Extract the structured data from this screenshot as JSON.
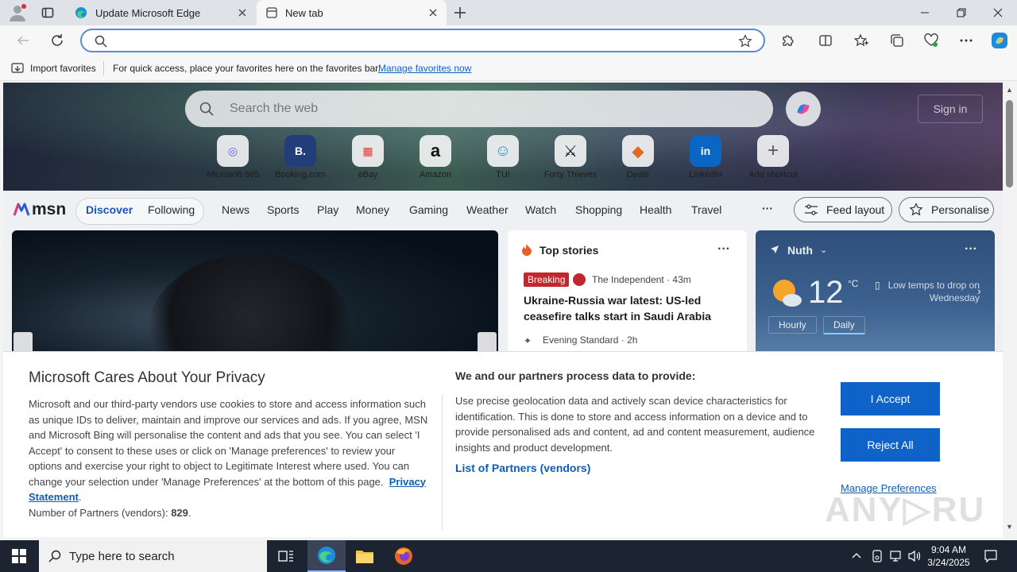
{
  "tabs": [
    {
      "title": "Update Microsoft Edge",
      "active": false
    },
    {
      "title": "New tab",
      "active": true
    }
  ],
  "address_bar": {
    "value": ""
  },
  "favorites_bar": {
    "import_label": "Import favorites",
    "hint": "For quick access, place your favorites here on the favorites bar.",
    "manage_link": "Manage favorites now"
  },
  "newtab": {
    "search_placeholder": "Search the web",
    "sign_in": "Sign in",
    "shortcuts": [
      {
        "label": "Microsoft 365",
        "glyph": "◎"
      },
      {
        "label": "Booking.com",
        "glyph": "B."
      },
      {
        "label": "eBay",
        "glyph": "▦"
      },
      {
        "label": "Amazon",
        "glyph": "a"
      },
      {
        "label": "TUI",
        "glyph": "☺"
      },
      {
        "label": "Forty Thieves",
        "glyph": "⚔"
      },
      {
        "label": "Deals",
        "glyph": "◆"
      },
      {
        "label": "LinkedIn",
        "glyph": "in"
      },
      {
        "label": "Add shortcut",
        "glyph": "+"
      }
    ]
  },
  "msn_nav": {
    "logo": "msn",
    "discover": "Discover",
    "following": "Following",
    "items": [
      "News",
      "Sports",
      "Play",
      "Money",
      "Gaming",
      "Weather",
      "Watch",
      "Shopping",
      "Health",
      "Travel"
    ],
    "more": "···",
    "feed_layout": "Feed layout",
    "personalise": "Personalise"
  },
  "top_stories": {
    "title": "Top stories",
    "more": "···",
    "badge": "Breaking",
    "source1": "The Independent · 43m",
    "headline": "Ukraine-Russia war latest: US-led ceasefire talks start in Saudi Arabia afte...",
    "source2": "Evening Standard · 2h"
  },
  "weather": {
    "location": "Nuth",
    "more": "···",
    "temp": "12",
    "unit": "°C",
    "note": "Low temps to drop on Wednesday",
    "tab_hourly": "Hourly",
    "tab_daily": "Daily"
  },
  "privacy": {
    "title": "Microsoft Cares About Your Privacy",
    "body": "Microsoft and our third-party vendors use cookies to store and access information such as unique IDs to deliver, maintain and improve our services and ads. If you agree, MSN and Microsoft Bing will personalise the content and ads that you see. You can select 'I Accept' to consent to these uses or click on 'Manage preferences' to review your options and exercise your right to object to Legitimate Interest where used.  You can change your selection under 'Manage Preferences' at the bottom of this page.",
    "privacy_link": "Privacy Statement",
    "partners_label": "Number of Partners (vendors):",
    "partners_count": "829",
    "right_title": "We and our partners process data to provide:",
    "right_body": "Use precise geolocation data and actively scan device characteristics for identification. This is done to store and access information on a device and to provide personalised ads and content, ad and content measurement, audience insights and product development.",
    "partners_link": "List of Partners (vendors)",
    "accept": "I Accept",
    "reject": "Reject All",
    "manage": "Manage Preferences"
  },
  "taskbar": {
    "search_placeholder": "Type here to search",
    "time": "9:04 AM",
    "date": "3/24/2025"
  },
  "colors": {
    "accent": "#0f62c7",
    "taskbar": "#1c2431",
    "breaking": "#c4262e"
  }
}
